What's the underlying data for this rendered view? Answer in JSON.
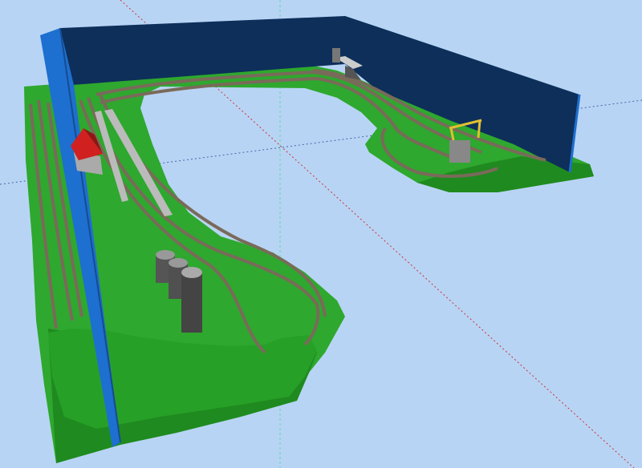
{
  "viewport": {
    "title": "",
    "background_color": "#b8d4f4",
    "grid_axis_colors": {
      "vertical": "#5fd9a8",
      "diagonal": "#cc3333",
      "horizontal": "#4466aa"
    }
  },
  "scene": {
    "baseboard_color": "#2ea82e",
    "baseboard_dark_color": "#1f8a1f",
    "backdrop_color": "#0d2f5a",
    "backdrop_edge_color": "#1d6fd0",
    "track_color": "#7a6a5a",
    "objects": [
      {
        "name": "red-roof-building",
        "icon": "house-icon"
      },
      {
        "name": "grain-silo-group",
        "icon": "silo-icon"
      },
      {
        "name": "yellow-gantry-crane",
        "icon": "crane-icon"
      },
      {
        "name": "warehouse-block",
        "icon": "building-icon"
      }
    ]
  }
}
